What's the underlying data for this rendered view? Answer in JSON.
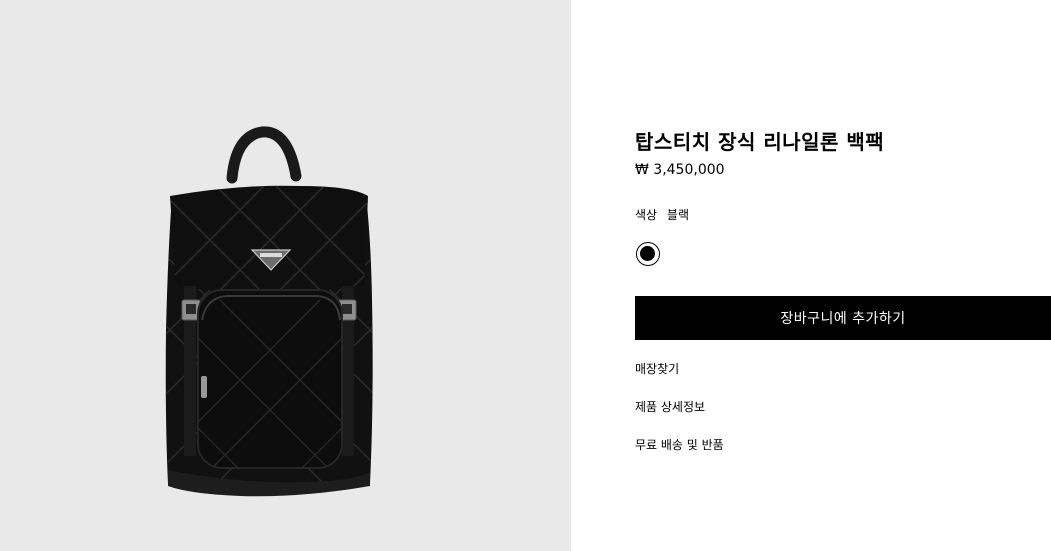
{
  "product": {
    "title": "탑스티치 장식 리나일론 백팩",
    "price": "₩ 3,450,000",
    "image_alt": "black quilted nylon backpack",
    "color_label": "색상",
    "color_value": "블랙",
    "swatches": [
      {
        "name": "블랙",
        "hex": "#000000",
        "selected": true
      }
    ]
  },
  "actions": {
    "add_to_cart_label": "장바구니에 추가하기"
  },
  "links": {
    "find_store": "매장찾기",
    "product_details": "제품 상세정보",
    "shipping_returns": "무료 배송 및 반품"
  },
  "colors": {
    "image_background": "#e9e9e9",
    "button_background": "#000000",
    "button_text": "#ffffff"
  }
}
